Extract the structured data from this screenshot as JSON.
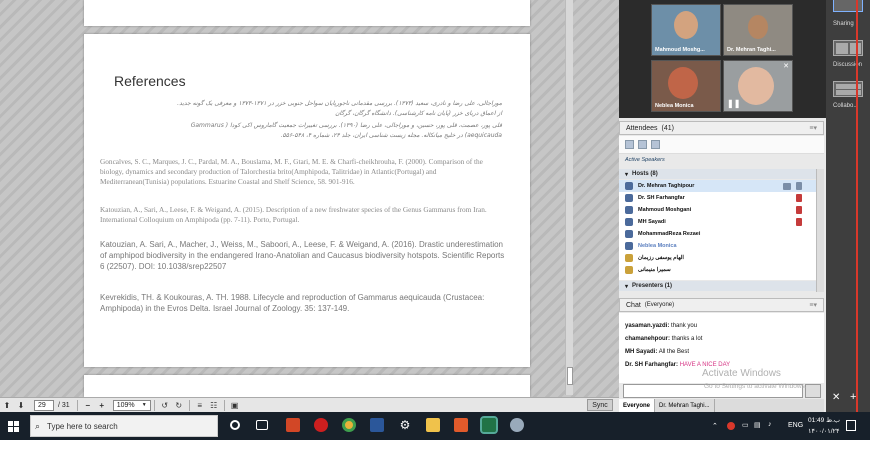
{
  "document": {
    "title": "References",
    "rtl_refs": [
      "موراجالی، علی رضا و نادری، سعید (۱۳۷۳). بررسی مقدماتی ناجورپایان سواحل جنوبی خزر در ۱۳۷۱-۱۳۷۳ و معرفی یک گونه جدید.",
      "از اعماق دریای خزر (پایان نامه کارشناسی). دانشگاه گرگان، گرگان",
      "قلی پور، عصمت، قلی پور، حسین، و موراجالی، علی رضا (۱۳۹۰). بررسی تغییرات جمعیت گاماروس اکی کودا ( Gammarus",
      "aequicauda) در خلیج میانکاله. مجله زیست شناسی ایران، جلد ۲۴، شماره ۴، ۵۴۸-۵۵۶."
    ],
    "refs": [
      {
        "text": "Goncalves, S. C., Marques, J. C., Pardal, M. A., Bouslama, M. F., Gtari, M. E. & Charfi-cheikhrouha, F. (2000). Comparison of the biology, dynamics and secondary production of Talorchestia brito(Amphipoda, Talitridae) in Atlantic(Portugal) and Mediterranean(Tunisia) populations. Estuarine Coastal and Shelf Science, 58. 901-916."
      },
      {
        "text": "Katouzian, A., Sari, A., Leese, F. & Weigand, A. (2015). Description of a new freshwater species of the Genus Gammarus from Iran. International Colloquium on Amphipoda (pp. 7-11). Porto, Portugal."
      },
      {
        "text": "Katouzian, A. Sari, A., Macher, J., Weiss, M., Saboori, A., Leese, F. & Weigand, A. (2016). Drastic underestimation of amphipod biodiversity in the endangered Irano-Anatolian and Caucasus biodiversity hotspots. Scientific Reports 6 (22507).  DOI: 10.1038/srep22507"
      },
      {
        "text": "Kevrekidis, TH. & Koukouras, A. TH. 1988. Lifecycle and reproduction of Gammarus aequicauda (Crustacea: Amphipoda) in the Evros Delta. Israel Journal of Zoology. 35: 137-149."
      }
    ]
  },
  "toolbar": {
    "page_current": "29",
    "page_total": "/ 31",
    "zoom": "109%",
    "sync": "Sync"
  },
  "video": {
    "tiles": [
      "Mahmoud Moshg...",
      "Dr. Mehran Taghi...",
      "Neblea Monica",
      ""
    ]
  },
  "attendees": {
    "title": "Attendees",
    "count": "(41)",
    "active_speakers": "Active Speakers",
    "hosts_label": "Hosts (8)",
    "presenters_label": "Presenters (1)",
    "list": [
      "Dr. Mehran Taghipour",
      "Dr. SH Farhangfar",
      "Mahmoud Moshgani",
      "MH  Sayadi",
      "MohammadReza Rezaei",
      "Neblea Monica",
      "الهام یوسفی رزیمان",
      "سمیرا منیمانی"
    ]
  },
  "chat": {
    "title": "Chat",
    "scope": "(Everyone)",
    "messages": [
      {
        "user": "yasaman.yazdi:",
        "text": "thank you"
      },
      {
        "user": "chamanehpour:",
        "text": "thanks a lot"
      },
      {
        "user": "MH  Sayadi:",
        "text": "All the Best"
      },
      {
        "user": "Dr. SH Farhangfar:",
        "text": "HAVE A NICE DAY"
      }
    ],
    "watermark": "Activate Windows",
    "watermark_sub": "Go to Settings to activate Windows.",
    "tabs": [
      "Everyone",
      "Dr. Mehran Taghi..."
    ]
  },
  "layouts": [
    "Sharing",
    "Discussion",
    "Collabo..."
  ],
  "taskbar": {
    "search_placeholder": "Type here to search",
    "lang": "ENG",
    "time": "01:49 ب.ظ",
    "date": "۱۴۰۰/۰۱/۲۴"
  }
}
